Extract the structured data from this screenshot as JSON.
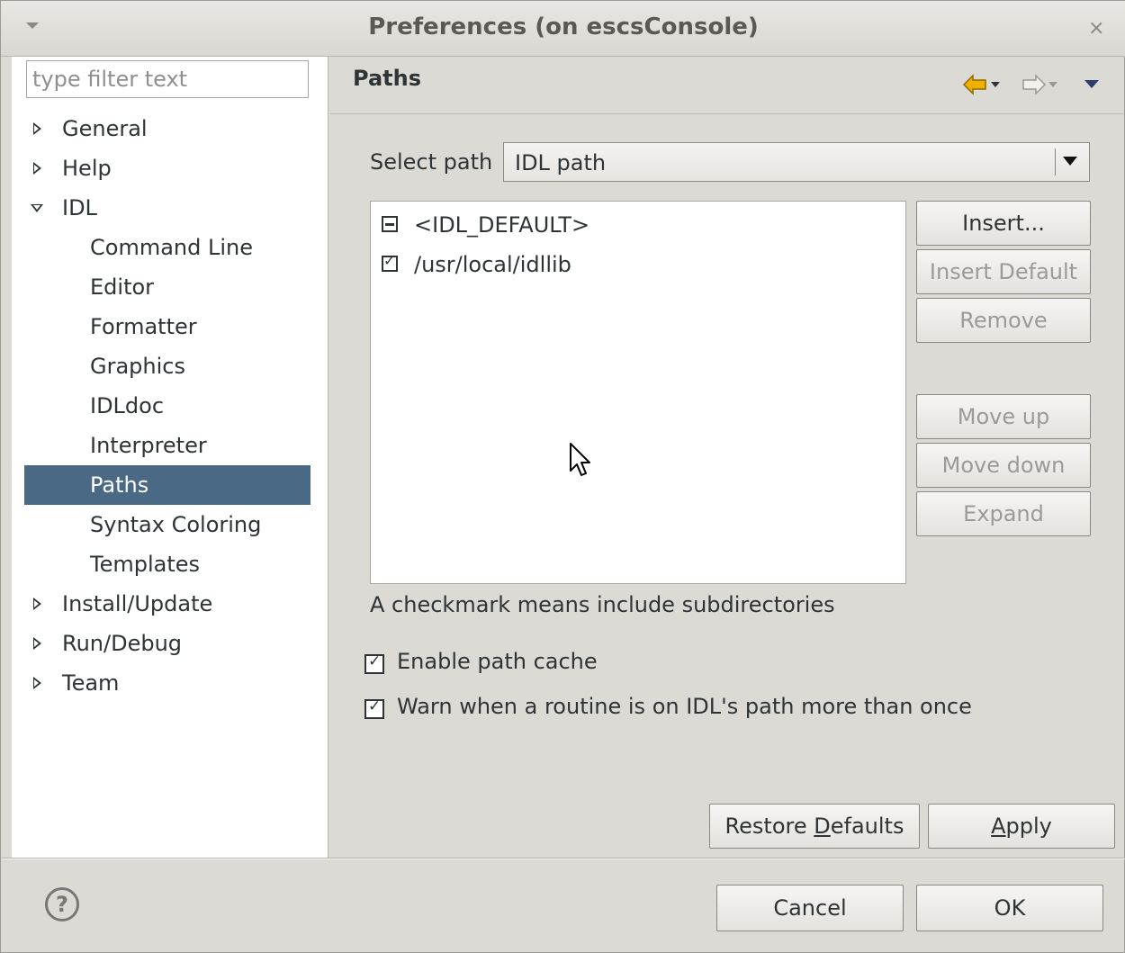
{
  "window": {
    "title": "Preferences  (on escsConsole)",
    "close_glyph": "×"
  },
  "sidebar": {
    "filter_placeholder": "type filter text",
    "items": [
      {
        "label": "General",
        "expandable": true,
        "expanded": false
      },
      {
        "label": "Help",
        "expandable": true,
        "expanded": false
      },
      {
        "label": "IDL",
        "expandable": true,
        "expanded": true
      },
      {
        "label": "Command Line"
      },
      {
        "label": "Editor"
      },
      {
        "label": "Formatter"
      },
      {
        "label": "Graphics"
      },
      {
        "label": "IDLdoc"
      },
      {
        "label": "Interpreter"
      },
      {
        "label": "Paths",
        "selected": true
      },
      {
        "label": "Syntax Coloring"
      },
      {
        "label": "Templates"
      },
      {
        "label": "Install/Update",
        "expandable": true,
        "expanded": false
      },
      {
        "label": "Run/Debug",
        "expandable": true,
        "expanded": false
      },
      {
        "label": "Team",
        "expandable": true,
        "expanded": false
      }
    ]
  },
  "page": {
    "title": "Paths",
    "select_path_label": "Select path",
    "select_path_value": "IDL path",
    "paths": [
      {
        "label": "<IDL_DEFAULT>",
        "state": "partial"
      },
      {
        "label": "/usr/local/idllib",
        "state": "checked"
      }
    ],
    "buttons": {
      "insert": "Insert...",
      "insert_default": "Insert Default",
      "remove": "Remove",
      "move_up": "Move up",
      "move_down": "Move down",
      "expand": "Expand"
    },
    "hint": "A checkmark means include subdirectories",
    "enable_cache": {
      "label": "Enable path cache",
      "checked": true
    },
    "warn_duplicate": {
      "label": "Warn when a routine is on IDL's path more than once",
      "checked": true
    },
    "restore_defaults_pre": "Restore ",
    "restore_defaults_mnemonic": "D",
    "restore_defaults_post": "efaults",
    "apply_mnemonic": "A",
    "apply_post": "pply"
  },
  "footer": {
    "help_glyph": "?",
    "cancel": "Cancel",
    "ok": "OK"
  },
  "colors": {
    "selection": "#4a6984",
    "window_bg": "#dcdad5",
    "nav_back_arrow": "#f0b000",
    "nav_menu": "#2e3c6b"
  }
}
